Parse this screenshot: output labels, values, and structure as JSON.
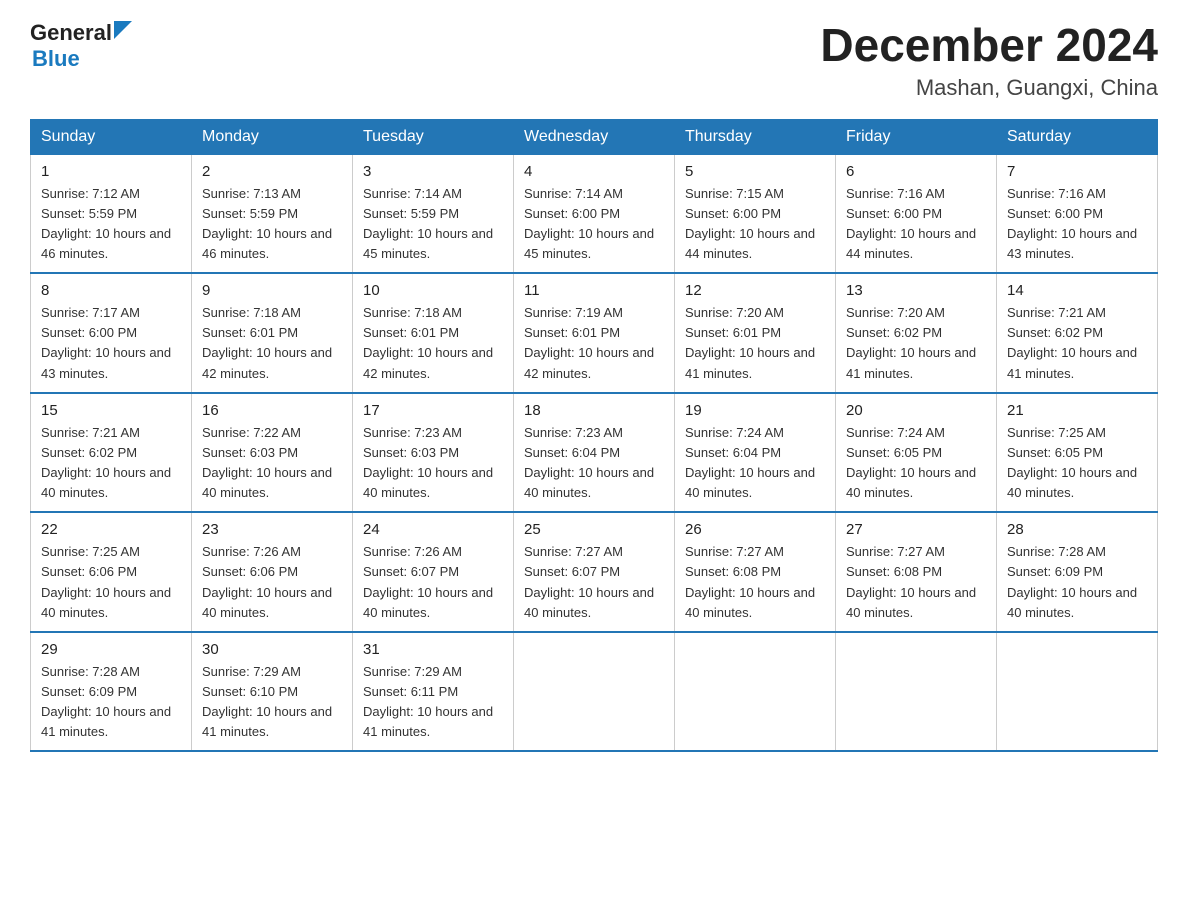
{
  "logo": {
    "text_general": "General",
    "text_blue": "Blue"
  },
  "header": {
    "month": "December 2024",
    "location": "Mashan, Guangxi, China"
  },
  "days_of_week": [
    "Sunday",
    "Monday",
    "Tuesday",
    "Wednesday",
    "Thursday",
    "Friday",
    "Saturday"
  ],
  "weeks": [
    [
      {
        "day": "1",
        "sunrise": "7:12 AM",
        "sunset": "5:59 PM",
        "daylight": "10 hours and 46 minutes."
      },
      {
        "day": "2",
        "sunrise": "7:13 AM",
        "sunset": "5:59 PM",
        "daylight": "10 hours and 46 minutes."
      },
      {
        "day": "3",
        "sunrise": "7:14 AM",
        "sunset": "5:59 PM",
        "daylight": "10 hours and 45 minutes."
      },
      {
        "day": "4",
        "sunrise": "7:14 AM",
        "sunset": "6:00 PM",
        "daylight": "10 hours and 45 minutes."
      },
      {
        "day": "5",
        "sunrise": "7:15 AM",
        "sunset": "6:00 PM",
        "daylight": "10 hours and 44 minutes."
      },
      {
        "day": "6",
        "sunrise": "7:16 AM",
        "sunset": "6:00 PM",
        "daylight": "10 hours and 44 minutes."
      },
      {
        "day": "7",
        "sunrise": "7:16 AM",
        "sunset": "6:00 PM",
        "daylight": "10 hours and 43 minutes."
      }
    ],
    [
      {
        "day": "8",
        "sunrise": "7:17 AM",
        "sunset": "6:00 PM",
        "daylight": "10 hours and 43 minutes."
      },
      {
        "day": "9",
        "sunrise": "7:18 AM",
        "sunset": "6:01 PM",
        "daylight": "10 hours and 42 minutes."
      },
      {
        "day": "10",
        "sunrise": "7:18 AM",
        "sunset": "6:01 PM",
        "daylight": "10 hours and 42 minutes."
      },
      {
        "day": "11",
        "sunrise": "7:19 AM",
        "sunset": "6:01 PM",
        "daylight": "10 hours and 42 minutes."
      },
      {
        "day": "12",
        "sunrise": "7:20 AM",
        "sunset": "6:01 PM",
        "daylight": "10 hours and 41 minutes."
      },
      {
        "day": "13",
        "sunrise": "7:20 AM",
        "sunset": "6:02 PM",
        "daylight": "10 hours and 41 minutes."
      },
      {
        "day": "14",
        "sunrise": "7:21 AM",
        "sunset": "6:02 PM",
        "daylight": "10 hours and 41 minutes."
      }
    ],
    [
      {
        "day": "15",
        "sunrise": "7:21 AM",
        "sunset": "6:02 PM",
        "daylight": "10 hours and 40 minutes."
      },
      {
        "day": "16",
        "sunrise": "7:22 AM",
        "sunset": "6:03 PM",
        "daylight": "10 hours and 40 minutes."
      },
      {
        "day": "17",
        "sunrise": "7:23 AM",
        "sunset": "6:03 PM",
        "daylight": "10 hours and 40 minutes."
      },
      {
        "day": "18",
        "sunrise": "7:23 AM",
        "sunset": "6:04 PM",
        "daylight": "10 hours and 40 minutes."
      },
      {
        "day": "19",
        "sunrise": "7:24 AM",
        "sunset": "6:04 PM",
        "daylight": "10 hours and 40 minutes."
      },
      {
        "day": "20",
        "sunrise": "7:24 AM",
        "sunset": "6:05 PM",
        "daylight": "10 hours and 40 minutes."
      },
      {
        "day": "21",
        "sunrise": "7:25 AM",
        "sunset": "6:05 PM",
        "daylight": "10 hours and 40 minutes."
      }
    ],
    [
      {
        "day": "22",
        "sunrise": "7:25 AM",
        "sunset": "6:06 PM",
        "daylight": "10 hours and 40 minutes."
      },
      {
        "day": "23",
        "sunrise": "7:26 AM",
        "sunset": "6:06 PM",
        "daylight": "10 hours and 40 minutes."
      },
      {
        "day": "24",
        "sunrise": "7:26 AM",
        "sunset": "6:07 PM",
        "daylight": "10 hours and 40 minutes."
      },
      {
        "day": "25",
        "sunrise": "7:27 AM",
        "sunset": "6:07 PM",
        "daylight": "10 hours and 40 minutes."
      },
      {
        "day": "26",
        "sunrise": "7:27 AM",
        "sunset": "6:08 PM",
        "daylight": "10 hours and 40 minutes."
      },
      {
        "day": "27",
        "sunrise": "7:27 AM",
        "sunset": "6:08 PM",
        "daylight": "10 hours and 40 minutes."
      },
      {
        "day": "28",
        "sunrise": "7:28 AM",
        "sunset": "6:09 PM",
        "daylight": "10 hours and 40 minutes."
      }
    ],
    [
      {
        "day": "29",
        "sunrise": "7:28 AM",
        "sunset": "6:09 PM",
        "daylight": "10 hours and 41 minutes."
      },
      {
        "day": "30",
        "sunrise": "7:29 AM",
        "sunset": "6:10 PM",
        "daylight": "10 hours and 41 minutes."
      },
      {
        "day": "31",
        "sunrise": "7:29 AM",
        "sunset": "6:11 PM",
        "daylight": "10 hours and 41 minutes."
      },
      null,
      null,
      null,
      null
    ]
  ]
}
